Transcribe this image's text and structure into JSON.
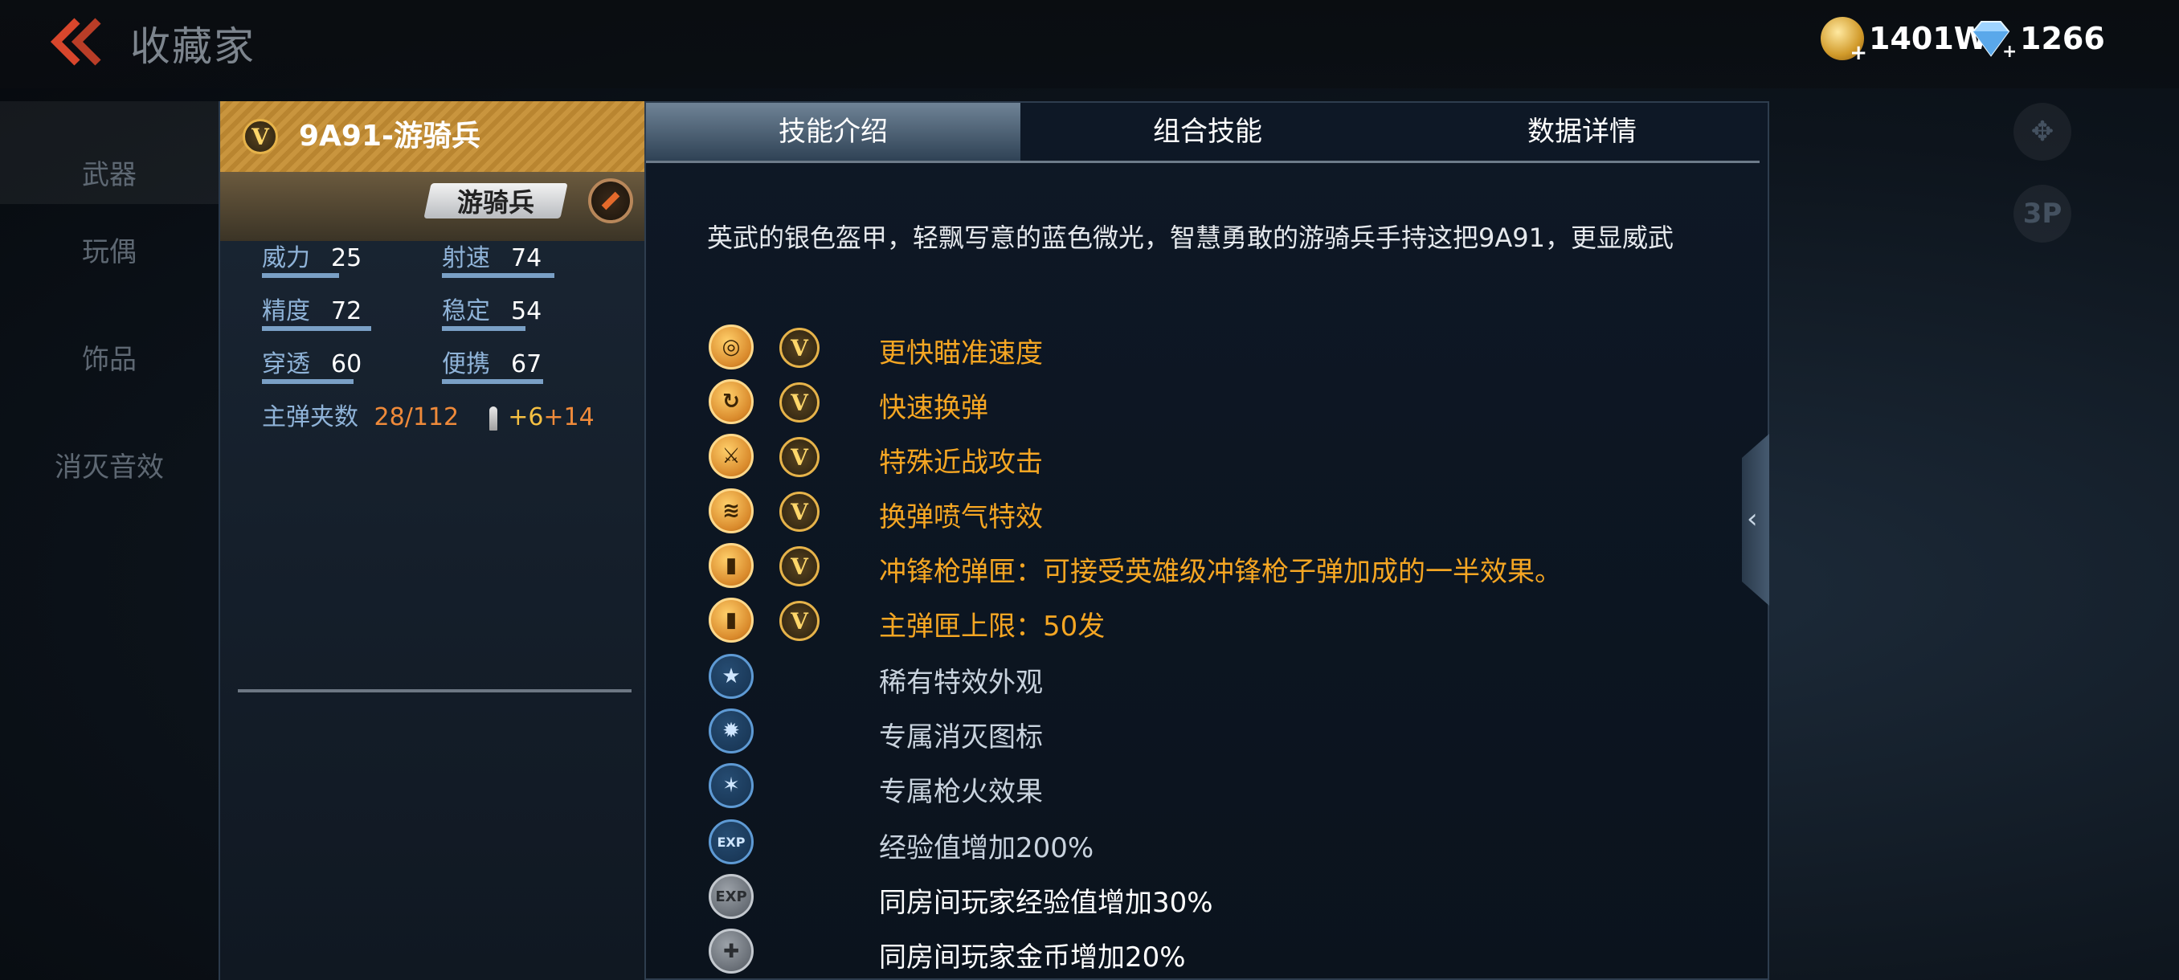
{
  "header": {
    "title": "收藏家",
    "gold": "1401W",
    "diamonds": "1266"
  },
  "left_nav": {
    "items": [
      "武器",
      "玩偶",
      "饰品",
      "消灭音效"
    ]
  },
  "weapon": {
    "name": "9A91-游骑兵",
    "rank_tag": "游骑兵",
    "stats": [
      {
        "label": "威力",
        "value": "25"
      },
      {
        "label": "射速",
        "value": "74"
      },
      {
        "label": "精度",
        "value": "72"
      },
      {
        "label": "稳定",
        "value": "54"
      },
      {
        "label": "穿透",
        "value": "60"
      },
      {
        "label": "便携",
        "value": "67"
      }
    ],
    "ammo_label": "主弹夹数",
    "ammo_value": "28/112",
    "ammo_bonus_1": "+6",
    "ammo_bonus_2": "+14"
  },
  "tabs": [
    "技能介绍",
    "组合技能",
    "数据详情"
  ],
  "description": "英武的银色盔甲，轻飘写意的蓝色微光，智慧勇敢的游骑兵手持这把9A91，更显威武",
  "skills": [
    {
      "icon": "scope-icon",
      "text": "更快瞄准速度"
    },
    {
      "icon": "reload-icon",
      "text": "快速换弹"
    },
    {
      "icon": "melee-icon",
      "text": "特殊近战攻击"
    },
    {
      "icon": "steam-icon",
      "text": "换弹喷气特效"
    },
    {
      "icon": "magazine-icon",
      "text": "冲锋枪弹匣：可接受英雄级冲锋枪子弹加成的一半效果。"
    },
    {
      "icon": "magazine-up-icon",
      "text": "主弹匣上限：50发"
    },
    {
      "icon": "star-icon",
      "text": "稀有特效外观"
    },
    {
      "icon": "kill-icon",
      "text": "专属消灭图标"
    },
    {
      "icon": "muzzle-flash-icon",
      "text": "专属枪火效果"
    },
    {
      "icon": "exp-icon",
      "text": "经验值增加200%"
    },
    {
      "icon": "room-exp-icon",
      "text": "同房间玩家经验值增加30%"
    },
    {
      "icon": "room-gold-icon",
      "text": "同房间玩家金币增加20%"
    }
  ],
  "side_buttons": {
    "view": "3P"
  },
  "colors": {
    "accent_gold": "#f5a623",
    "panel_bg": "#0e1826",
    "stat_bar": "#7aa0c6"
  }
}
